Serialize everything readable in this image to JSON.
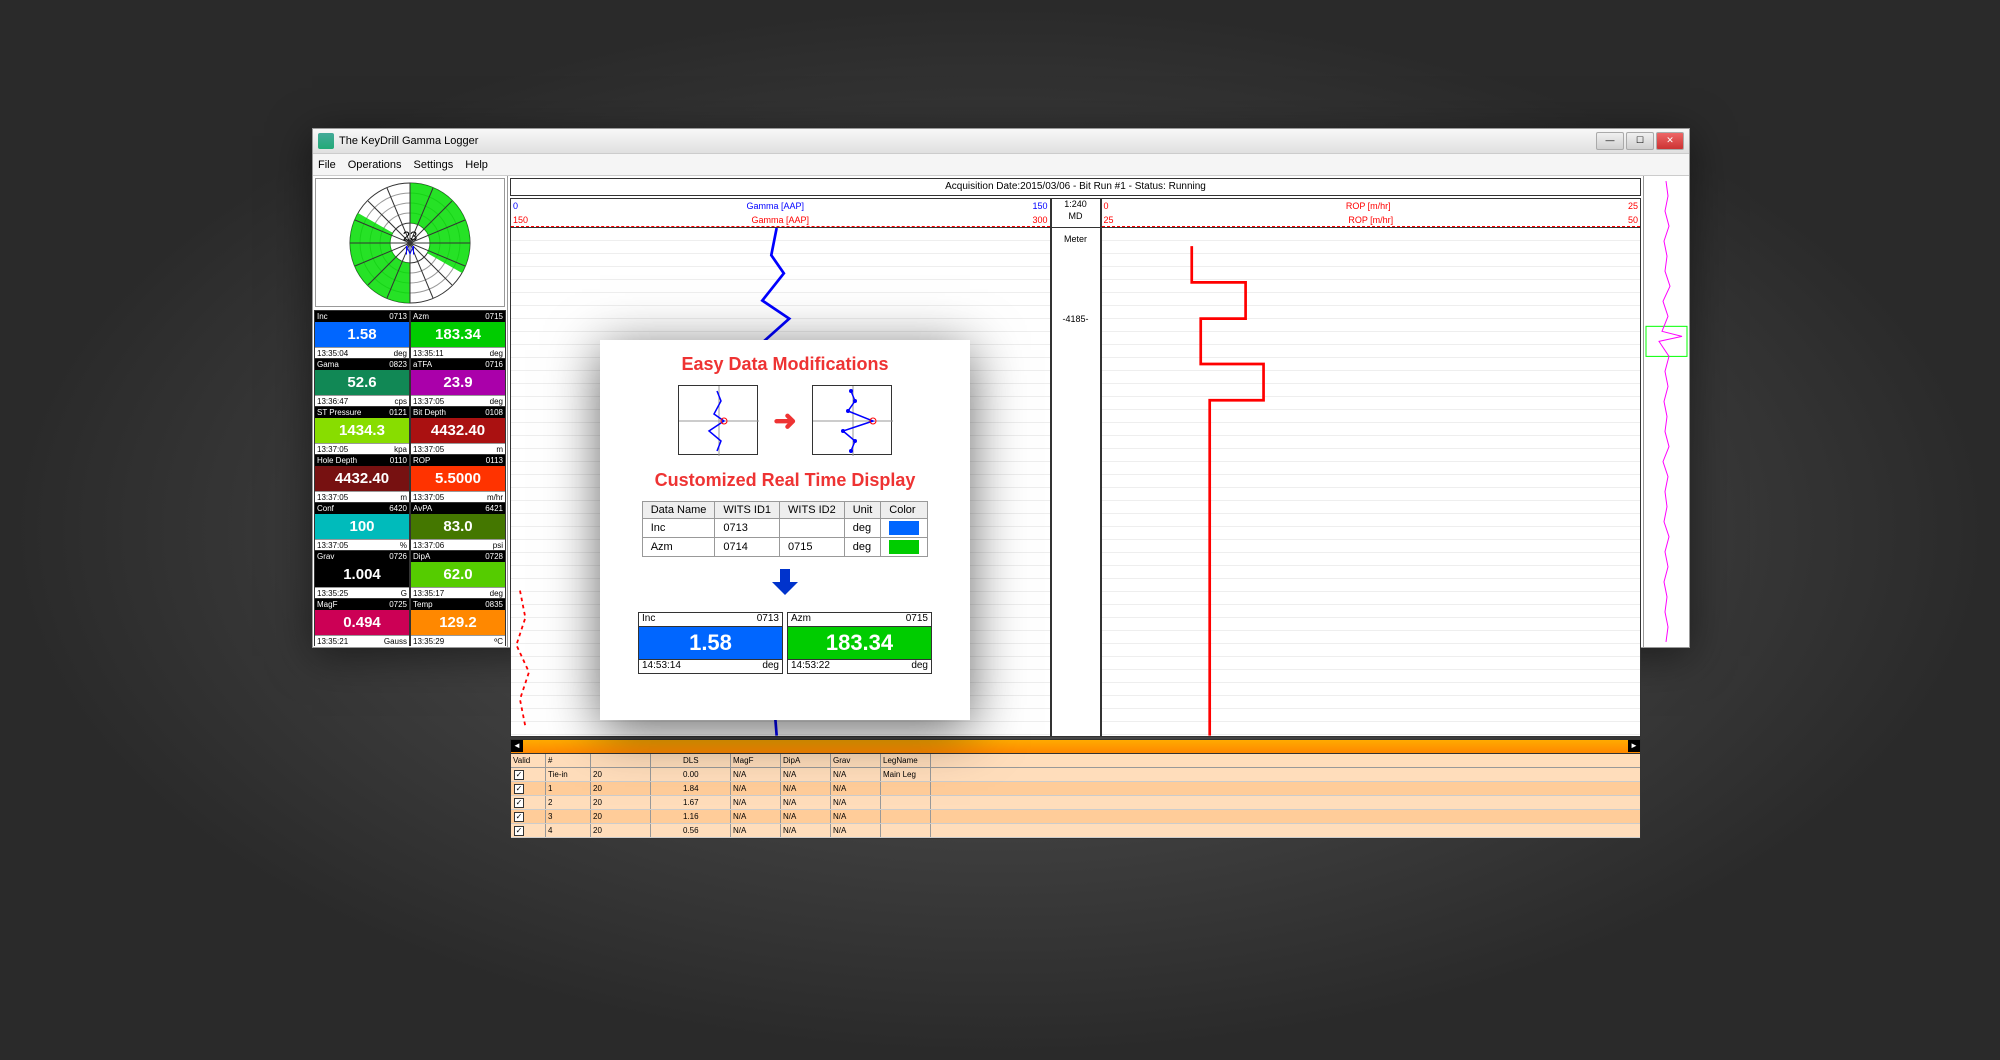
{
  "window": {
    "title": "The KeyDrill Gamma Logger"
  },
  "menu": [
    "File",
    "Operations",
    "Settings",
    "Help"
  ],
  "acquisition": "Acquisition Date:2015/03/06 - Bit Run #1 - Status: Running",
  "gauge": {
    "value": "23",
    "unit": "M"
  },
  "scale": {
    "ratio": "1:240",
    "unit": "MD",
    "unit2": "Meter",
    "depth": "-4185-"
  },
  "track1": {
    "label": "Gamma [AAP]",
    "min1": "0",
    "max1": "150",
    "min2": "150",
    "max2": "300"
  },
  "track2": {
    "label": "ROP [m/hr]",
    "min1": "0",
    "max1": "25",
    "min2": "25",
    "max2": "50"
  },
  "tiles": [
    {
      "name": "Inc",
      "id": "0713",
      "val": "1.58",
      "time": "13:35:04",
      "unit": "deg",
      "bg": "#06f"
    },
    {
      "name": "Azm",
      "id": "0715",
      "val": "183.34",
      "time": "13:35:11",
      "unit": "deg",
      "bg": "#0c0"
    },
    {
      "name": "Gama",
      "id": "0823",
      "val": "52.6",
      "time": "13:36:47",
      "unit": "cps",
      "bg": "#185"
    },
    {
      "name": "aTFA",
      "id": "0716",
      "val": "23.9",
      "time": "13:37:05",
      "unit": "deg",
      "bg": "#a0a"
    },
    {
      "name": "ST Pressure",
      "id": "0121",
      "val": "1434.3",
      "time": "13:37:05",
      "unit": "kpa",
      "bg": "#8d0"
    },
    {
      "name": "Bit Depth",
      "id": "0108",
      "val": "4432.40",
      "time": "13:37:05",
      "unit": "m",
      "bg": "#a11"
    },
    {
      "name": "Hole Depth",
      "id": "0110",
      "val": "4432.40",
      "time": "13:37:05",
      "unit": "m",
      "bg": "#711"
    },
    {
      "name": "ROP",
      "id": "0113",
      "val": "5.5000",
      "time": "13:37:05",
      "unit": "m/hr",
      "bg": "#f30"
    },
    {
      "name": "Conf",
      "id": "6420",
      "val": "100",
      "time": "13:37:05",
      "unit": "%",
      "bg": "#0bb"
    },
    {
      "name": "AvPA",
      "id": "6421",
      "val": "83.0",
      "time": "13:37:06",
      "unit": "psi",
      "bg": "#470"
    },
    {
      "name": "Grav",
      "id": "0726",
      "val": "1.004",
      "time": "13:35:25",
      "unit": "G",
      "bg": "#000"
    },
    {
      "name": "DipA",
      "id": "0728",
      "val": "62.0",
      "time": "13:35:17",
      "unit": "deg",
      "bg": "#5c0"
    },
    {
      "name": "MagF",
      "id": "0725",
      "val": "0.494",
      "time": "13:35:21",
      "unit": "Gauss",
      "bg": "#c05"
    },
    {
      "name": "Temp",
      "id": "0835",
      "val": "129.2",
      "time": "13:35:29",
      "unit": "ºC",
      "bg": "#f80"
    }
  ],
  "leftTable": {
    "headers": [
      "Valid",
      "#",
      ""
    ],
    "rows": [
      [
        "✓",
        "Tie-in",
        "20"
      ],
      [
        "✓",
        "1",
        "20"
      ],
      [
        "✓",
        "2",
        "20"
      ],
      [
        "✓",
        "3",
        "20"
      ],
      [
        "✓",
        "4",
        "20"
      ]
    ]
  },
  "rightTable": {
    "headers": [
      "DLS",
      "MagF",
      "DipA",
      "Grav",
      "LegName"
    ],
    "rows": [
      [
        "0.00",
        "N/A",
        "N/A",
        "N/A",
        "Main Leg"
      ],
      [
        "1.84",
        "N/A",
        "N/A",
        "N/A",
        ""
      ],
      [
        "1.67",
        "N/A",
        "N/A",
        "N/A",
        ""
      ],
      [
        "1.16",
        "N/A",
        "N/A",
        "N/A",
        ""
      ],
      [
        "0.56",
        "N/A",
        "N/A",
        "N/A",
        ""
      ]
    ]
  },
  "overlay": {
    "title1": "Easy Data Modifications",
    "title2": "Customized Real Time Display",
    "tableHeaders": [
      "Data Name",
      "WITS ID1",
      "WITS ID2",
      "Unit",
      "Color"
    ],
    "tableRows": [
      [
        "Inc",
        "0713",
        "",
        "deg",
        "#06f"
      ],
      [
        "Azm",
        "0714",
        "0715",
        "deg",
        "#0c0"
      ]
    ],
    "tiles": [
      {
        "name": "Inc",
        "id": "0713",
        "val": "1.58",
        "time": "14:53:14",
        "unit": "deg",
        "bg": "#06f"
      },
      {
        "name": "Azm",
        "id": "0715",
        "val": "183.34",
        "time": "14:53:22",
        "unit": "deg",
        "bg": "#0c0"
      }
    ]
  }
}
